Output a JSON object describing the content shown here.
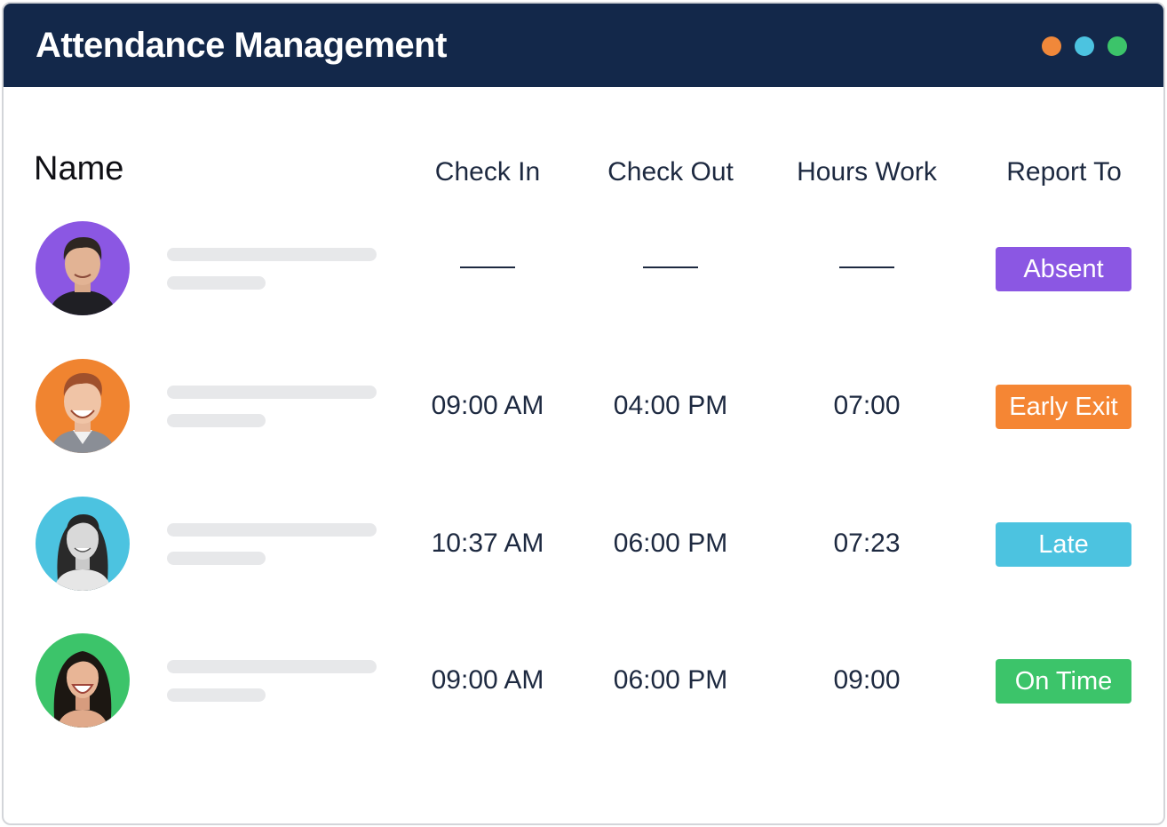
{
  "window": {
    "title": "Attendance Management",
    "controls": [
      {
        "name": "orange-dot",
        "color": "#f0883a"
      },
      {
        "name": "blue-dot",
        "color": "#4cc3e0"
      },
      {
        "name": "green-dot",
        "color": "#3cc46a"
      }
    ]
  },
  "table": {
    "headers": {
      "name": "Name",
      "check_in": "Check In",
      "check_out": "Check Out",
      "hours_work": "Hours Work",
      "report_to": "Report To"
    },
    "rows": [
      {
        "avatar_color": "#8b57e3",
        "check_in": "",
        "check_out": "",
        "hours": "",
        "status": "Absent",
        "status_color": "#8b57e3"
      },
      {
        "avatar_color": "#f08430",
        "check_in": "09:00 AM",
        "check_out": "04:00 PM",
        "hours": "07:00",
        "status": "Early Exit",
        "status_color": "#f58634"
      },
      {
        "avatar_color": "#4cc3e0",
        "check_in": "10:37 AM",
        "check_out": "06:00 PM",
        "hours": "07:23",
        "status": "Late",
        "status_color": "#4cc3e0"
      },
      {
        "avatar_color": "#3cc46a",
        "check_in": "09:00 AM",
        "check_out": "06:00 PM",
        "hours": "09:00",
        "status": "On Time",
        "status_color": "#3cc46a"
      }
    ]
  }
}
